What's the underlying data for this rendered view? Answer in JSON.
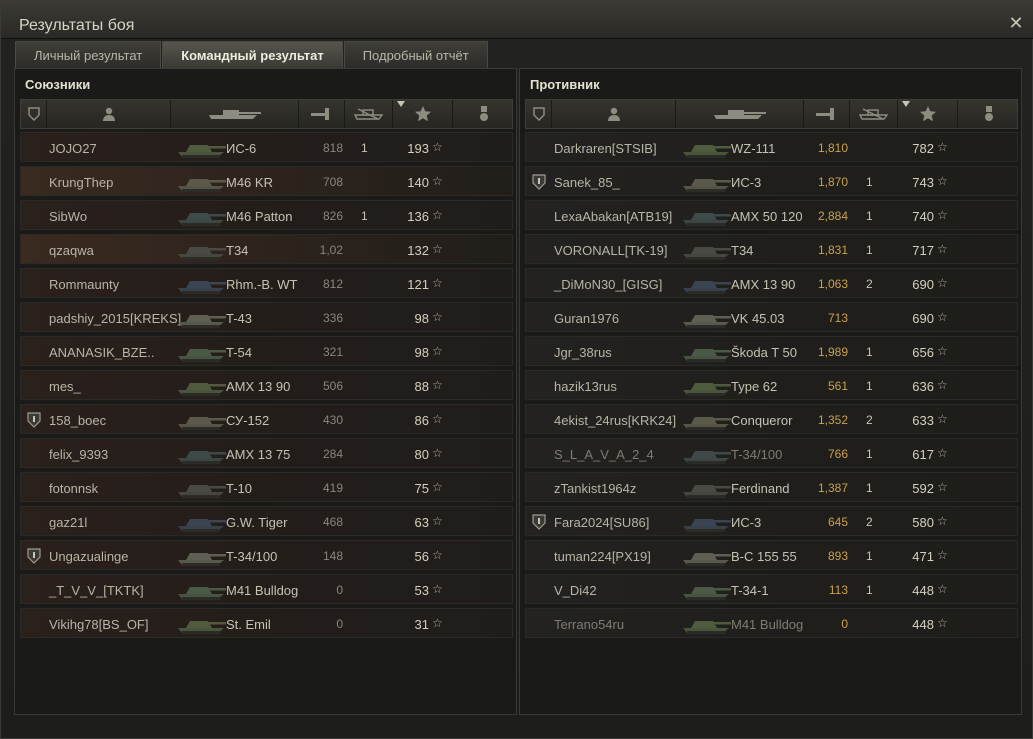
{
  "window": {
    "title": "Результаты боя"
  },
  "tabs": [
    {
      "label": "Личный результат"
    },
    {
      "label": "Командный результат"
    },
    {
      "label": "Подробный отчёт"
    }
  ],
  "allies": {
    "title": "Союзники",
    "rows": [
      {
        "player": "JOJO27",
        "vehicle": "ИС-6",
        "damage": "818",
        "kills": "1",
        "xp": "193"
      },
      {
        "player": "KrungThep",
        "vehicle": "M46 KR",
        "damage": "708",
        "kills": "",
        "xp": "140"
      },
      {
        "player": "SibWo",
        "vehicle": "M46 Patton",
        "damage": "826",
        "kills": "1",
        "xp": "136"
      },
      {
        "player": "qzaqwa",
        "vehicle": "T34",
        "damage": "1,02",
        "kills": "",
        "xp": "132"
      },
      {
        "player": "Rommaunty",
        "vehicle": "Rhm.-B. WT",
        "damage": "812",
        "kills": "",
        "xp": "121"
      },
      {
        "player": "padshiy_2015[KREKS]",
        "vehicle": "T-43",
        "damage": "336",
        "kills": "",
        "xp": "98"
      },
      {
        "player": "ANANASIK_BZE..",
        "vehicle": "T-54",
        "damage": "321",
        "kills": "",
        "xp": "98"
      },
      {
        "player": "mes_",
        "vehicle": "AMX 13 90",
        "damage": "506",
        "kills": "",
        "xp": "88"
      },
      {
        "player": "158_boec",
        "vehicle": "СУ-152",
        "damage": "430",
        "kills": "",
        "xp": "86"
      },
      {
        "player": "felix_9393",
        "vehicle": "AMX 13 75",
        "damage": "284",
        "kills": "",
        "xp": "80"
      },
      {
        "player": "fotonnsk",
        "vehicle": "T-10",
        "damage": "419",
        "kills": "",
        "xp": "75"
      },
      {
        "player": "gaz21l",
        "vehicle": "G.W. Tiger",
        "damage": "468",
        "kills": "",
        "xp": "63"
      },
      {
        "player": "Ungazualinge",
        "vehicle": "T-34/100",
        "damage": "148",
        "kills": "",
        "xp": "56"
      },
      {
        "player": "_T_V_V_[TKTK]",
        "vehicle": "M41 Bulldog",
        "damage": "0",
        "kills": "",
        "xp": "53"
      },
      {
        "player": "Vikihg78[BS_OF]",
        "vehicle": "St. Emil",
        "damage": "0",
        "kills": "",
        "xp": "31"
      }
    ]
  },
  "enemies": {
    "title": "Противник",
    "rows": [
      {
        "player": "Darkraren[STSIB]",
        "vehicle": "WZ-111",
        "damage": "1,810",
        "kills": "",
        "xp": "782"
      },
      {
        "player": "Sanek_85_",
        "vehicle": "ИС-3",
        "damage": "1,870",
        "kills": "1",
        "xp": "743"
      },
      {
        "player": "LexaAbakan[ATB19]",
        "vehicle": "AMX 50 120",
        "damage": "2,884",
        "kills": "1",
        "xp": "740"
      },
      {
        "player": "VORONALL[TK-19]",
        "vehicle": "T34",
        "damage": "1,831",
        "kills": "1",
        "xp": "717"
      },
      {
        "player": "_DiMoN30_[GISG]",
        "vehicle": "AMX 13 90",
        "damage": "1,063",
        "kills": "2",
        "xp": "690"
      },
      {
        "player": "Guran1976",
        "vehicle": "VK 45.03",
        "damage": "713",
        "kills": "",
        "xp": "690"
      },
      {
        "player": "Jgr_38rus",
        "vehicle": "Škoda T 50",
        "damage": "1,989",
        "kills": "1",
        "xp": "656"
      },
      {
        "player": "hazik13rus",
        "vehicle": "Type 62",
        "damage": "561",
        "kills": "1",
        "xp": "636"
      },
      {
        "player": "4ekist_24rus[KRK24]",
        "vehicle": "Conqueror",
        "damage": "1,352",
        "kills": "2",
        "xp": "633"
      },
      {
        "player": "S_L_A_V_A_2_4",
        "vehicle": "T-34/100",
        "damage": "766",
        "kills": "1",
        "xp": "617"
      },
      {
        "player": "zTankist1964z",
        "vehicle": "Ferdinand",
        "damage": "1,387",
        "kills": "1",
        "xp": "592"
      },
      {
        "player": "Fara2024[SU86]",
        "vehicle": "ИС-3",
        "damage": "645",
        "kills": "2",
        "xp": "580"
      },
      {
        "player": "tuman224[PX19]",
        "vehicle": "В-С 155 55",
        "damage": "893",
        "kills": "1",
        "xp": "471"
      },
      {
        "player": "V_Di42",
        "vehicle": "T-34-1",
        "damage": "113",
        "kills": "1",
        "xp": "448"
      },
      {
        "player": "Terrano54ru",
        "vehicle": "M41 Bulldog",
        "damage": "0",
        "kills": "",
        "xp": "448"
      }
    ]
  },
  "icons": {
    "close": "close-icon",
    "squad": "squad-icon",
    "player": "player-icon",
    "tank": "tank-icon",
    "damage": "damage-icon",
    "kills": "kills-icon",
    "xp": "star-icon",
    "medal": "medal-icon"
  }
}
